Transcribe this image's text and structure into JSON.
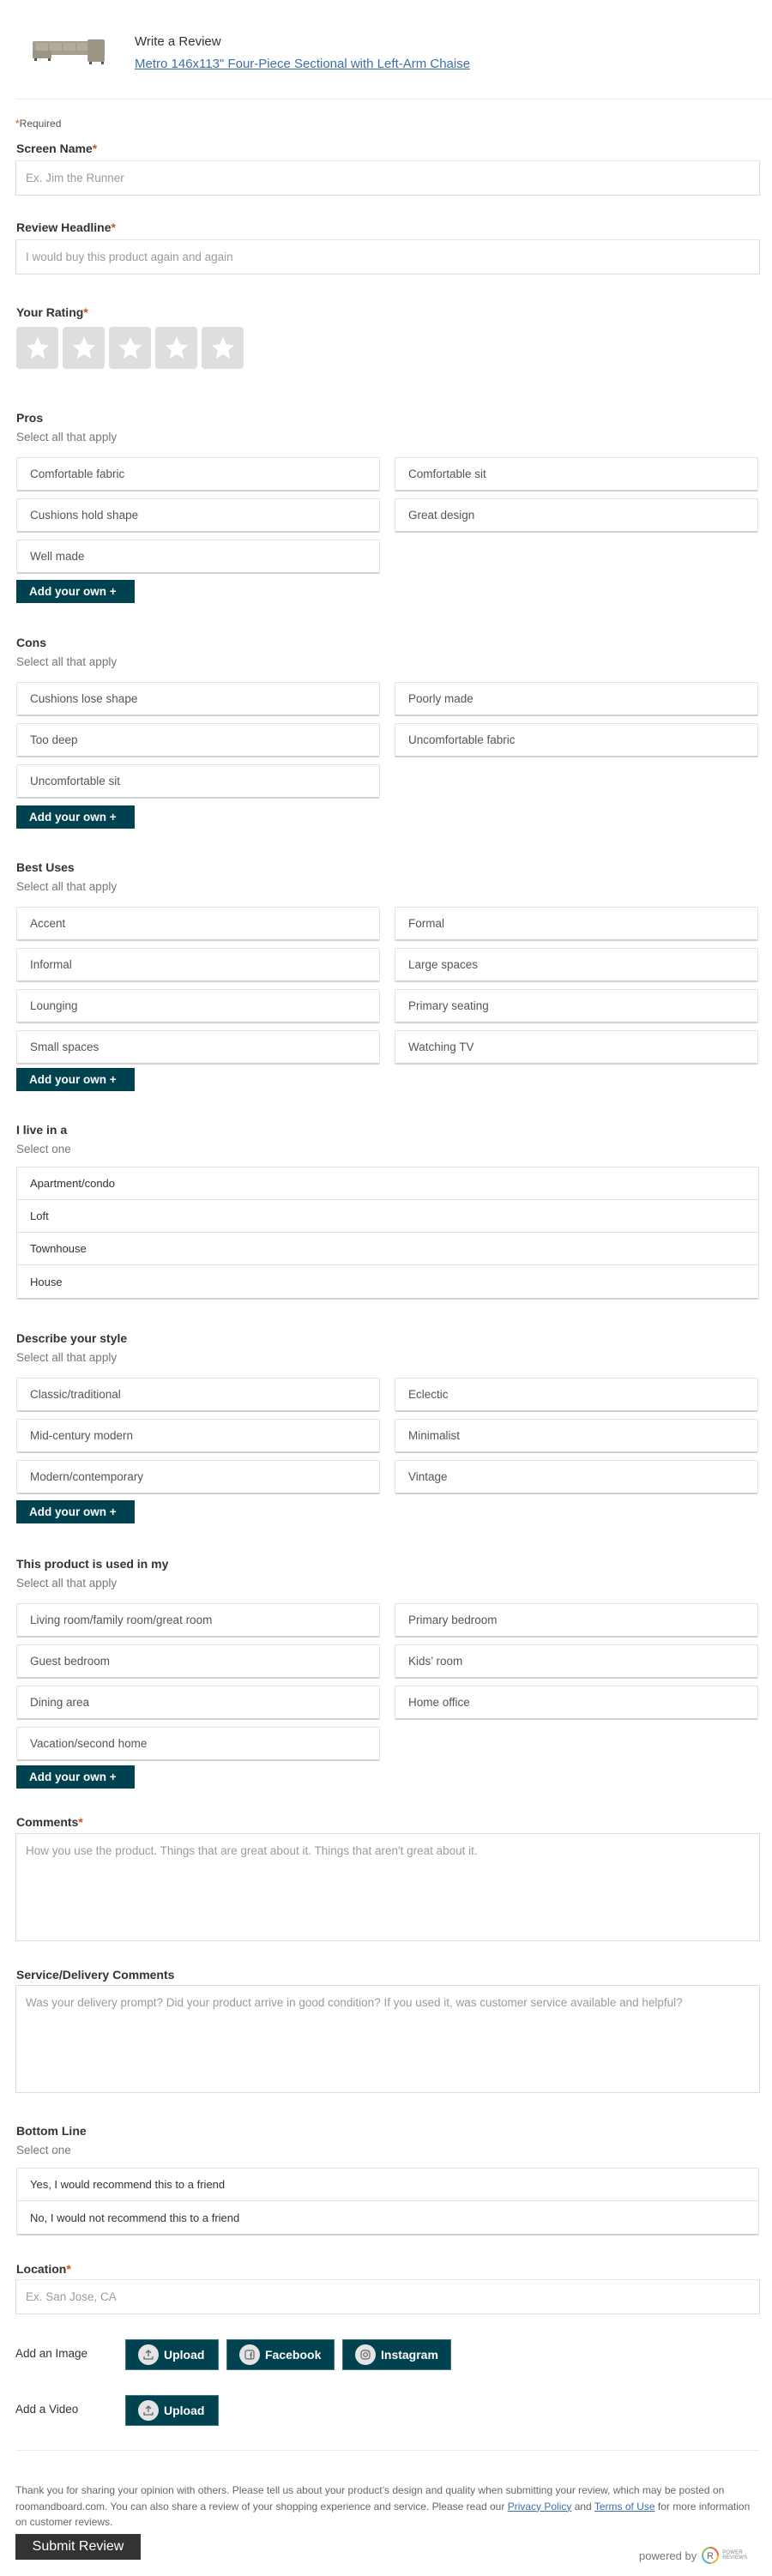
{
  "header": {
    "title": "Write a Review",
    "product_link": "Metro 146x113\" Four-Piece Sectional with Left-Arm Chaise",
    "product_image_alt": "sectional-sofa-image"
  },
  "required_note": "Required",
  "required_marker": "*",
  "screen_name": {
    "label": "Screen Name",
    "placeholder": "Ex. Jim the Runner",
    "value": ""
  },
  "headline": {
    "label": "Review Headline",
    "placeholder": "I would buy this product again and again",
    "value": ""
  },
  "rating": {
    "label": "Your Rating",
    "max": 5,
    "value": 0
  },
  "pros": {
    "label": "Pros",
    "sub": "Select all that apply",
    "options": [
      "Comfortable fabric",
      "Comfortable sit",
      "Cushions hold shape",
      "Great design",
      "Well made"
    ],
    "add_label": "Add your own +"
  },
  "cons": {
    "label": "Cons",
    "sub": "Select all that apply",
    "options": [
      "Cushions lose shape",
      "Poorly made",
      "Too deep",
      "Uncomfortable fabric",
      "Uncomfortable sit"
    ],
    "add_label": "Add your own +"
  },
  "best_uses": {
    "label": "Best Uses",
    "sub": "Select all that apply",
    "options": [
      "Accent",
      "Formal",
      "Informal",
      "Large spaces",
      "Lounging",
      "Primary seating",
      "Small spaces",
      "Watching TV"
    ],
    "add_label": "Add your own +"
  },
  "live_in": {
    "label": "I live in a",
    "sub": "Select one",
    "options": [
      "Apartment/condo",
      "Loft",
      "Townhouse",
      "House"
    ]
  },
  "style": {
    "label": "Describe your style",
    "sub": "Select all that apply",
    "options": [
      "Classic/traditional",
      "Eclectic",
      "Mid-century modern",
      "Minimalist",
      "Modern/contemporary",
      "Vintage"
    ],
    "add_label": "Add your own +"
  },
  "used_in": {
    "label": "This product is used in my",
    "sub": "Select all that apply",
    "options": [
      "Living room/family room/great room",
      "Primary bedroom",
      "Guest bedroom",
      "Kids’ room",
      "Dining area",
      "Home office",
      "Vacation/second home"
    ],
    "add_label": "Add your own +"
  },
  "comments": {
    "label": "Comments",
    "placeholder": "How you use the product. Things that are great about it. Things that aren't great about it."
  },
  "service_comments": {
    "label": "Service/Delivery Comments",
    "placeholder": "Was your delivery prompt? Did your product arrive in good condition? If you used it, was customer service available and helpful?"
  },
  "bottom_line": {
    "label": "Bottom Line",
    "sub": "Select one",
    "options": [
      "Yes, I would recommend this to a friend",
      "No, I would not recommend this to a friend"
    ]
  },
  "location": {
    "label": "Location",
    "placeholder": "Ex. San Jose, CA",
    "value": ""
  },
  "media": {
    "image_label": "Add an Image",
    "video_label": "Add a Video",
    "upload": "Upload",
    "facebook": "Facebook",
    "instagram": "Instagram"
  },
  "footer": {
    "disclaimer_1": "Thank you for sharing your opinion with others. Please tell us about your product’s design and quality when submitting your review, which may be posted on roomandboard.com. You can also share a review of your shopping experience and service. Please read our ",
    "privacy_link": "Privacy Policy",
    "and": " and ",
    "terms_link": "Terms of Use",
    "disclaimer_2": " for more information on customer reviews.",
    "submit": "Submit Review",
    "powered_by": "powered by",
    "brand_line1": "POWER",
    "brand_line2": "REVIEWS"
  },
  "colors": {
    "accent_button": "#004250",
    "required_star": "#c8531f",
    "link": "#3f6fa8",
    "submit": "#333333",
    "star_bg": "#dedede"
  }
}
